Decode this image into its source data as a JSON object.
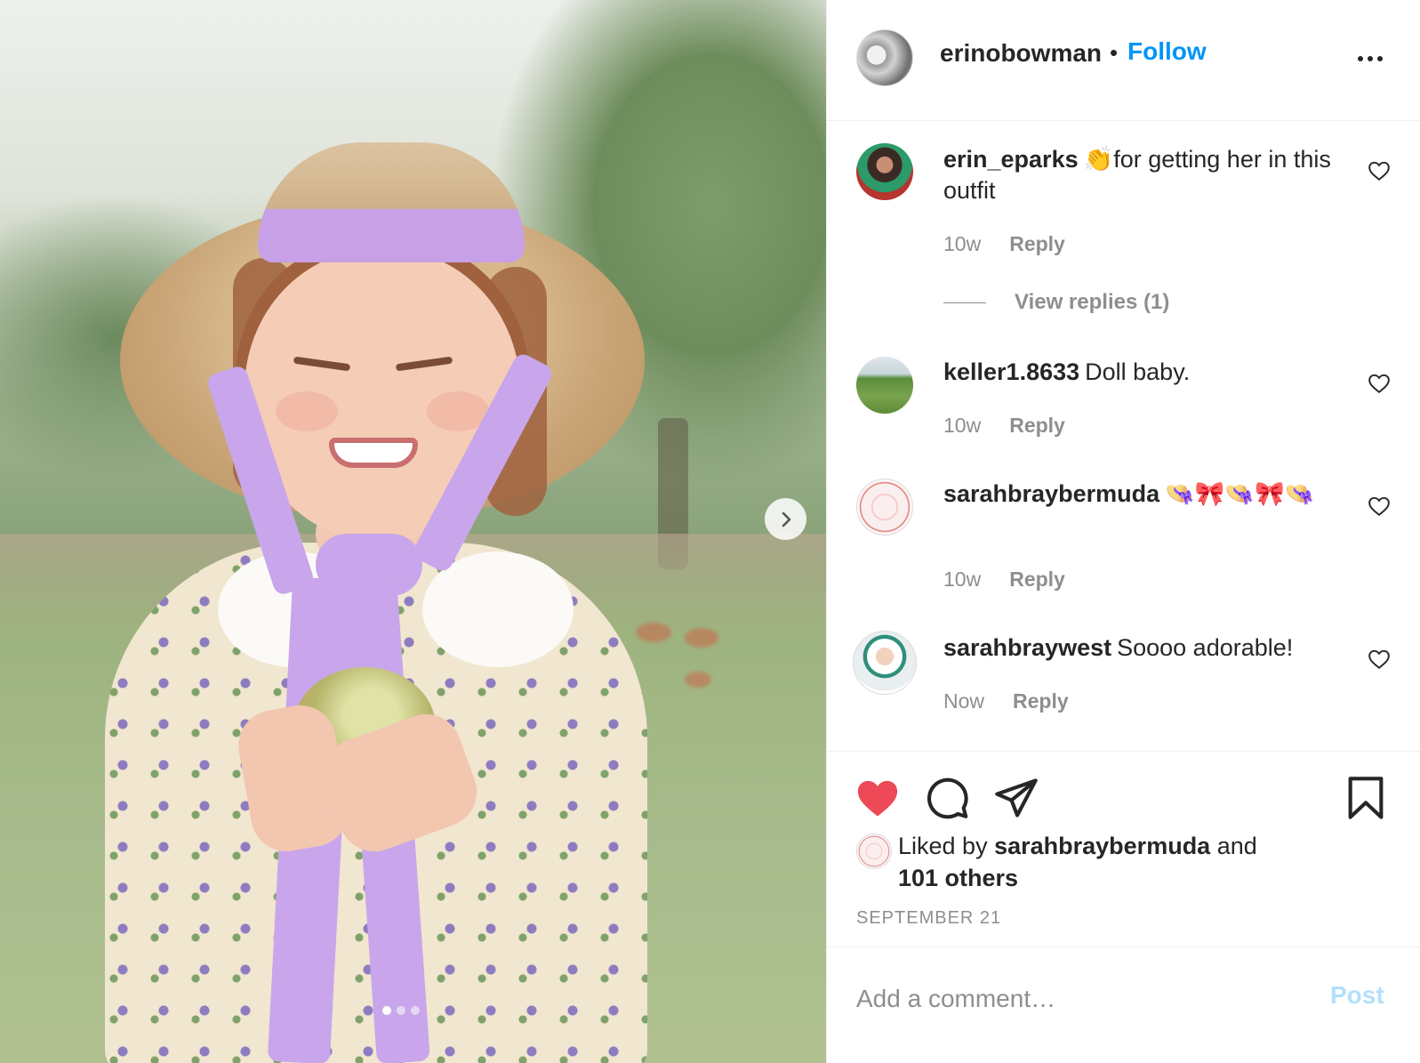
{
  "header": {
    "username": "erinobowman",
    "separator": "•",
    "follow_label": "Follow",
    "more_icon": "ellipsis-icon"
  },
  "carousel": {
    "next_icon": "chevron-right-icon",
    "slide_count": 3,
    "active_slide": 1
  },
  "comments": [
    {
      "username": "erin_eparks",
      "emoji": "👏",
      "text": "for getting her in this outfit",
      "time": "10w",
      "reply_label": "Reply",
      "view_replies": "View replies (1)"
    },
    {
      "username": "keller1.8633",
      "text": "Doll baby.",
      "time": "10w",
      "reply_label": "Reply"
    },
    {
      "username": "sarahbraybermuda",
      "text": "👒🎀👒🎀👒",
      "time": "10w",
      "reply_label": "Reply"
    },
    {
      "username": "sarahbraywest",
      "text": "Soooo adorable!",
      "time": "Now",
      "reply_label": "Reply"
    }
  ],
  "actions": {
    "like_icon": "heart-filled-icon",
    "comment_icon": "speech-bubble-icon",
    "share_icon": "paper-plane-icon",
    "save_icon": "bookmark-icon",
    "like_color": "#ed4956"
  },
  "likes": {
    "prefix": "Liked by",
    "user": "sarahbraybermuda",
    "joiner": "and",
    "others": "101 others"
  },
  "date": "SEPTEMBER 21",
  "add_comment": {
    "placeholder": "Add a comment…",
    "post_label": "Post"
  },
  "colors": {
    "link_blue": "#0095f6",
    "post_disabled": "#b2dffc",
    "muted": "#8e8e8e"
  }
}
